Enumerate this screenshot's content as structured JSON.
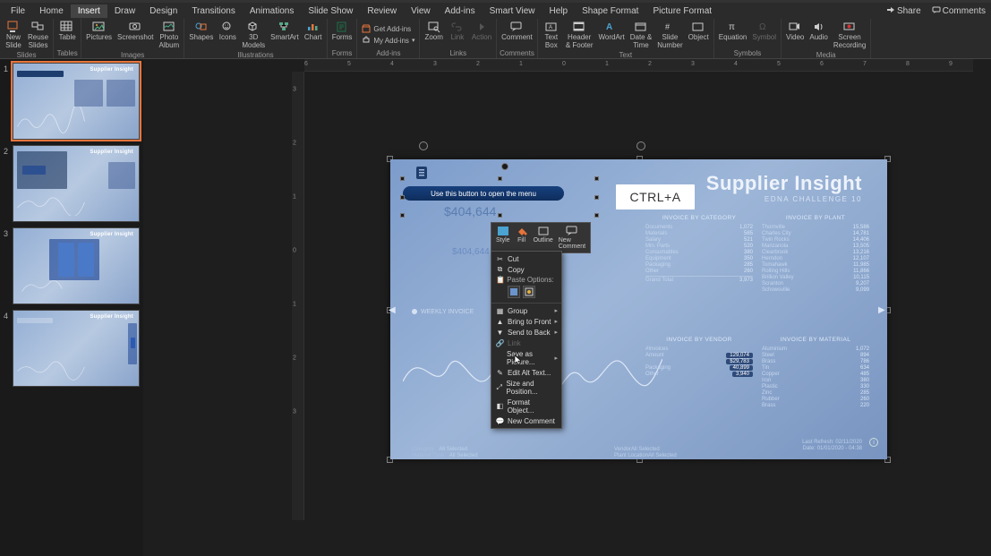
{
  "tabs": {
    "file": "File",
    "home": "Home",
    "insert": "Insert",
    "draw": "Draw",
    "design": "Design",
    "transitions": "Transitions",
    "animations": "Animations",
    "slideshow": "Slide Show",
    "review": "Review",
    "view": "View",
    "addins": "Add-ins",
    "smartview": "Smart View",
    "help": "Help",
    "shapeformat": "Shape Format",
    "pictureformat": "Picture Format"
  },
  "titlebar": {
    "share": "Share",
    "comments": "Comments"
  },
  "ribbon": {
    "slides": {
      "new": "New\nSlide",
      "reuse": "Reuse\nSlides",
      "group": "Slides"
    },
    "tables": {
      "table": "Table",
      "group": "Tables"
    },
    "images": {
      "pictures": "Pictures",
      "screenshot": "Screenshot",
      "album": "Photo\nAlbum",
      "group": "Images"
    },
    "illustrations": {
      "shapes": "Shapes",
      "icons": "Icons",
      "models": "3D\nModels",
      "smartart": "SmartArt",
      "chart": "Chart",
      "group": "Illustrations"
    },
    "forms": {
      "forms": "Forms",
      "group": "Forms"
    },
    "addins": {
      "get": "Get Add-ins",
      "my": "My Add-ins",
      "group": "Add-ins"
    },
    "links": {
      "zoom": "Zoom",
      "link": "Link",
      "action": "Action",
      "group": "Links"
    },
    "comments": {
      "comment": "Comment",
      "group": "Comments"
    },
    "text": {
      "textbox": "Text\nBox",
      "header": "Header\n& Footer",
      "wordart": "WordArt",
      "datetime": "Date &\nTime",
      "slidenum": "Slide\nNumber",
      "object": "Object",
      "group": "Text"
    },
    "symbols": {
      "equation": "Equation",
      "symbol": "Symbol",
      "group": "Symbols"
    },
    "media": {
      "video": "Video",
      "audio": "Audio",
      "screenrec": "Screen\nRecording",
      "group": "Media"
    }
  },
  "thumbs": {
    "n1": "1",
    "n2": "2",
    "n3": "3",
    "n4": "4",
    "title": "Supplier Insight"
  },
  "ruler": {
    "h": [
      "6",
      "5",
      "4",
      "3",
      "2",
      "1",
      "0",
      "1",
      "2",
      "3",
      "4",
      "5",
      "6",
      "7",
      "8",
      "9"
    ],
    "v": [
      "3",
      "2",
      "1",
      "0",
      "1",
      "2",
      "3"
    ]
  },
  "slide": {
    "title1": "Supplier Insight",
    "title2": "EDNA CHALLENGE 10",
    "pill_text": "Use this button to open the menu",
    "dollar": "$404,644",
    "dollar2": "$404,644",
    "ctrl_a": "CTRL+A",
    "weekly": "WEEKLY INVOICE",
    "footer": {
      "cat": "Category",
      "catv": "All Selected",
      "mat": "Material Type",
      "matv": "All Selected",
      "ven": "Vendor",
      "venv": "All Selected",
      "plant": "Plant Location",
      "plantv": "All Selected",
      "r1": "Last Refresh: 02/11/2020",
      "r2": "Date: 01/01/2020 - 04:38"
    },
    "panels": {
      "p1": {
        "hd": "INVOICE BY CATEGORY",
        "rows": [
          [
            "Documents",
            "1,072"
          ],
          [
            "Materials",
            "585"
          ],
          [
            "Salary",
            "521"
          ],
          [
            "Min. Parts",
            "520"
          ],
          [
            "Consumables",
            "380"
          ],
          [
            "Equipment",
            "350"
          ],
          [
            "Packaging",
            "285"
          ],
          [
            "Other",
            "260"
          ]
        ],
        "total": [
          "Grand Total",
          "3,973"
        ]
      },
      "p2": {
        "hd": "INVOICE BY PLANT",
        "rows": [
          [
            "Thornville",
            "15,586"
          ],
          [
            "Charles City",
            "14,781"
          ],
          [
            "Twin Rocks",
            "14,406"
          ],
          [
            "Manzanola",
            "13,505"
          ],
          [
            "Clearbrook",
            "13,216"
          ],
          [
            "Herndon",
            "12,107"
          ],
          [
            "Tomahawk",
            "11,985"
          ],
          [
            "Rolling Hills",
            "11,866"
          ],
          [
            "Brillion Valley",
            "10,115"
          ],
          [
            "Scranton",
            "9,207"
          ],
          [
            "Schowsville",
            "9,099"
          ]
        ]
      },
      "p3": {
        "hd": "INVOICE BY VENDOR",
        "rows": [
          [
            "#Invoices",
            ""
          ],
          [
            "Amount",
            "129,074"
          ],
          [
            "",
            "$29,783"
          ],
          [
            "Packaging",
            "40,899"
          ],
          [
            "Other",
            "3,940"
          ]
        ]
      },
      "p4": {
        "hd": "INVOICE BY MATERIAL",
        "rows": [
          [
            "Aluminium",
            "1,072"
          ],
          [
            "Steel",
            "894"
          ],
          [
            "Brass",
            "786"
          ],
          [
            "Tin",
            "634"
          ],
          [
            "Copper",
            "485"
          ],
          [
            "Iron",
            "380"
          ],
          [
            "Plastic",
            "330"
          ],
          [
            "Zinc",
            "285"
          ],
          [
            "Rubber",
            "260"
          ],
          [
            "Brass",
            "220"
          ]
        ]
      }
    }
  },
  "minitb": {
    "style": "Style",
    "fill": "Fill",
    "outline": "Outline",
    "newc": "New\nComment"
  },
  "ctx": {
    "cut": "Cut",
    "copy": "Copy",
    "pasteopt": "Paste Options:",
    "group": "Group",
    "front": "Bring to Front",
    "back": "Send to Back",
    "link": "Link",
    "savepic": "Save as Picture...",
    "alt": "Edit Alt Text...",
    "sizepos": "Size and Position...",
    "fmt": "Format Object...",
    "newc": "New Comment"
  }
}
